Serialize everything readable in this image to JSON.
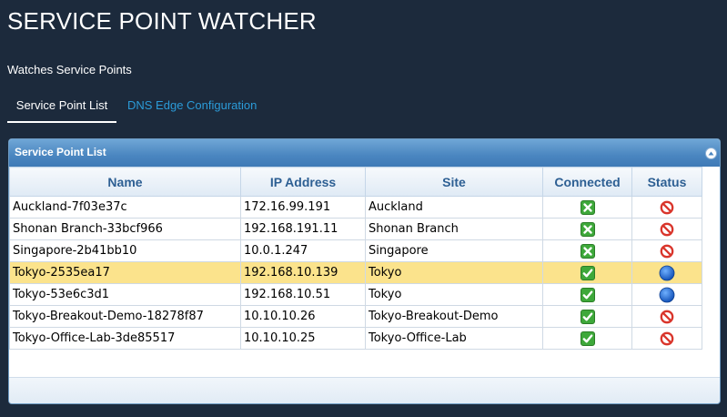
{
  "app": {
    "title": "SERVICE POINT WATCHER",
    "subtitle": "Watches Service Points"
  },
  "tabs": [
    {
      "label": "Service Point List",
      "active": true
    },
    {
      "label": "DNS Edge Configuration",
      "active": false
    }
  ],
  "panel": {
    "title": "Service Point List",
    "columns": [
      "Name",
      "IP Address",
      "Site",
      "Connected",
      "Status"
    ],
    "rows": [
      {
        "name": "Auckland-7f03e37c",
        "ip": "172.16.99.191",
        "site": "Auckland",
        "connected": "no",
        "status": "blocked"
      },
      {
        "name": "Shonan Branch-33bcf966",
        "ip": "192.168.191.11",
        "site": "Shonan Branch",
        "connected": "no",
        "status": "blocked"
      },
      {
        "name": "Singapore-2b41bb10",
        "ip": "10.0.1.247",
        "site": "Singapore",
        "connected": "no",
        "status": "blocked"
      },
      {
        "name": "Tokyo-2535ea17",
        "ip": "192.168.10.139",
        "site": "Tokyo",
        "connected": "yes",
        "status": "ok",
        "selected": true
      },
      {
        "name": "Tokyo-53e6c3d1",
        "ip": "192.168.10.51",
        "site": "Tokyo",
        "connected": "yes",
        "status": "ok"
      },
      {
        "name": "Tokyo-Breakout-Demo-18278f87",
        "ip": "10.10.10.26",
        "site": "Tokyo-Breakout-Demo",
        "connected": "yes",
        "status": "blocked"
      },
      {
        "name": "Tokyo-Office-Lab-3de85517",
        "ip": "10.10.10.25",
        "site": "Tokyo-Office-Lab",
        "connected": "yes",
        "status": "blocked"
      }
    ]
  },
  "icons": {
    "connected_no": "cross-box-icon",
    "connected_yes": "check-box-icon",
    "status_blocked": "prohibited-icon",
    "status_ok": "blue-dot-icon"
  },
  "colors": {
    "background": "#1c2a3c",
    "tab_link": "#2b9bd8",
    "header_blue": "#4a86c0",
    "selected_row": "#fbe38c",
    "check_green": "#3ea83a",
    "prohibited_red": "#d9352b",
    "status_blue": "#1f6fd1"
  }
}
